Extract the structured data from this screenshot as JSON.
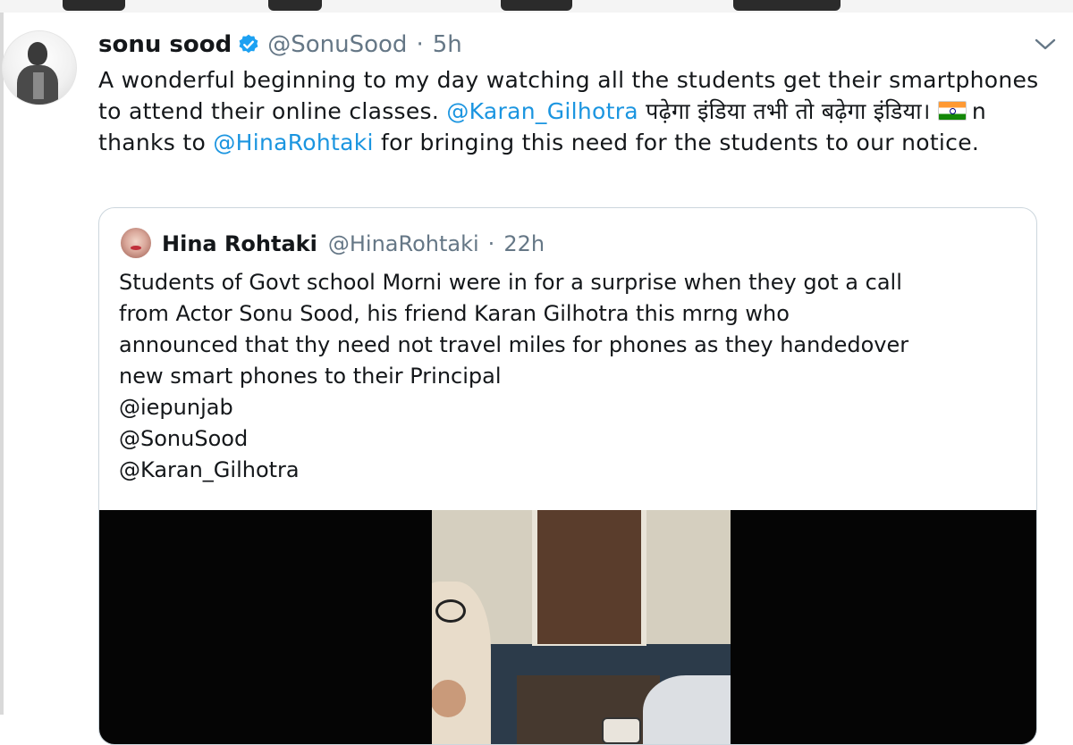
{
  "tweet": {
    "display_name": "sonu sood",
    "handle": "@SonuSood",
    "separator": "·",
    "time": "5h",
    "text": {
      "part1": "A wonderful beginning to my day watching all the students get their smartphones to attend their online classes. ",
      "mention1": "@Karan_Gilhotra",
      "part2": " पढ़ेगा इंडिया तभी तो बढ़ेगा इंडिया। ",
      "part3": "n thanks to ",
      "mention2": "@HinaRohtaki",
      "part4": " for bringing this need for the students to our notice."
    }
  },
  "quoted_tweet": {
    "display_name": "Hina Rohtaki",
    "handle": "@HinaRohtaki",
    "separator": "·",
    "time": "22h",
    "lines": [
      "Students of Govt school Morni were in for a surprise when they got a call",
      "from Actor Sonu Sood, his friend Karan Gilhotra this mrng who",
      "announced that thy need not travel miles for phones as they handedover",
      "new smart phones to their Principal",
      "@iepunjab",
      "@SonuSood",
      "@Karan_Gilhotra"
    ]
  },
  "icons": {
    "verified": "verified-badge-icon",
    "menu": "chevron-down-icon",
    "flag": "india-flag-emoji"
  },
  "colors": {
    "link": "#1b95e0",
    "secondary_text": "#657786",
    "verified": "#1da1f2",
    "border": "#ccd6dd"
  }
}
